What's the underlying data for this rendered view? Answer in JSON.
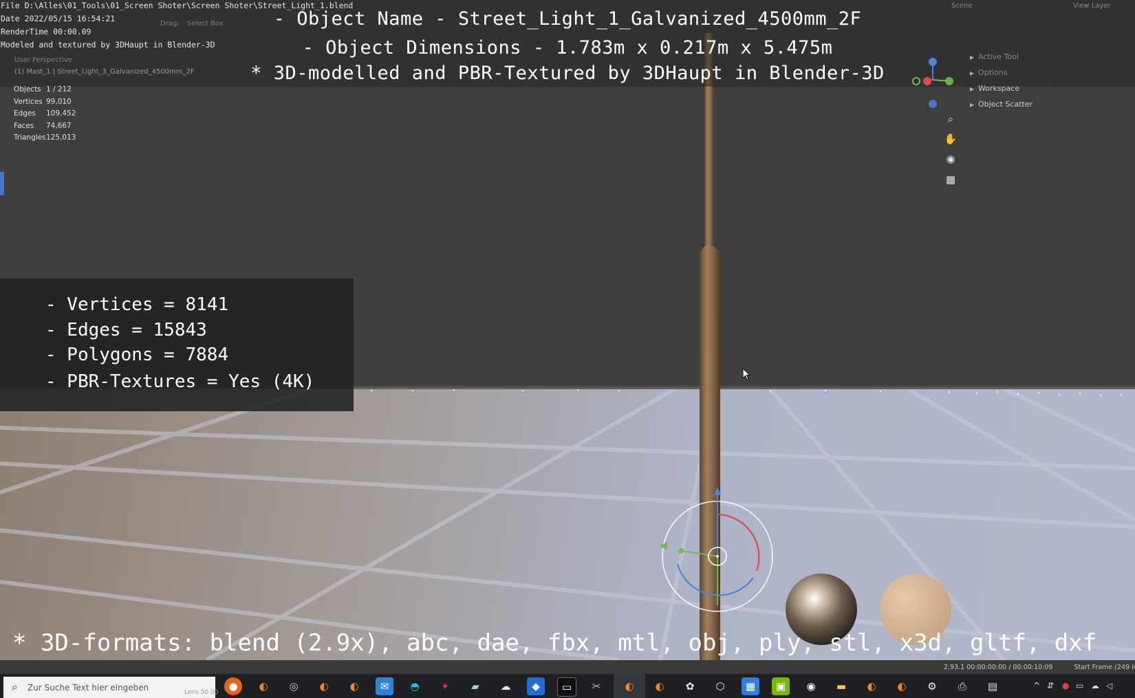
{
  "render_info": {
    "file": "File D:\\Alles\\01_Tools\\01_Screen Shoter\\Screen Shoter\\Street_Light_1.blend",
    "date": "Date 2022/05/15 16:54:21",
    "render_time": "RenderTime 00:00.09",
    "credit": "Modeled and textured by 3DHaupt in Blender-3D"
  },
  "viewport_header": {
    "drag_label": "Drag:",
    "drag_value": "Select Box",
    "perspective": "User Perspective",
    "object_path": "(1) Mast_1 | Street_Light_3_Galvanized_4500mm_2F"
  },
  "headlines": {
    "object_name": "- Object Name - Street_Light_1_Galvanized_4500mm_2F",
    "dimensions": "- Object Dimensions -  1.783m x 0.217m x 5.475m",
    "credit": "* 3D-modelled and PBR-Textured by 3DHaupt in Blender-3D"
  },
  "scene_stats": [
    {
      "label": "Objects",
      "value": "1 / 212"
    },
    {
      "label": "Vertices",
      "value": "99,010"
    },
    {
      "label": "Edges",
      "value": "109,452"
    },
    {
      "label": "Faces",
      "value": "74,667"
    },
    {
      "label": "Triangles",
      "value": "125,013"
    }
  ],
  "right_panel": {
    "scene_label": "Scene",
    "view_layer_label": "View Layer",
    "items": [
      "Active Tool",
      "Options",
      "Workspace",
      "Object Scatter"
    ]
  },
  "nav_icons": [
    "zoom-icon",
    "pan-hand-icon",
    "camera-icon",
    "grid-icon"
  ],
  "poly_stats": {
    "vertices": "- Vertices = 8141",
    "edges": "- Edges = 15843",
    "polygons": "- Polygons = 7884",
    "textures": "- PBR-Textures =  Yes (4K)"
  },
  "formats_line": "* 3D-formats: blend (2.9x), abc, dae, fbx, mtl, obj, ply, stl, x3d, gltf, dxf",
  "status_bar": {
    "version_time": "2.93.1   00:00:00:00 / 00:00:10:09",
    "start_frame": "Start Frame (249 le",
    "lens": "Lens 50.00"
  },
  "taskbar": {
    "search_placeholder": "Zur Suche Text hier eingeben",
    "icons": [
      "firefox-icon",
      "blender-icon",
      "obs-icon",
      "blender-icon",
      "blender-icon",
      "mail-icon",
      "edge-icon",
      "app-red-icon",
      "notes-icon",
      "cloud-icon",
      "shield-icon",
      "terminal-icon",
      "tools-icon",
      "blender-icon",
      "blender-icon",
      "panda-icon",
      "cube-icon",
      "calendar-icon",
      "nvidia-icon",
      "circle-app-icon",
      "folder-icon",
      "blender-icon",
      "blender-icon",
      "settings-icon",
      "printer-icon",
      "remote-icon"
    ]
  },
  "colors": {
    "x_axis": "#e0474f",
    "y_axis": "#6cc04a",
    "z_axis": "#4c84d8",
    "accent": "#4a78c8"
  }
}
